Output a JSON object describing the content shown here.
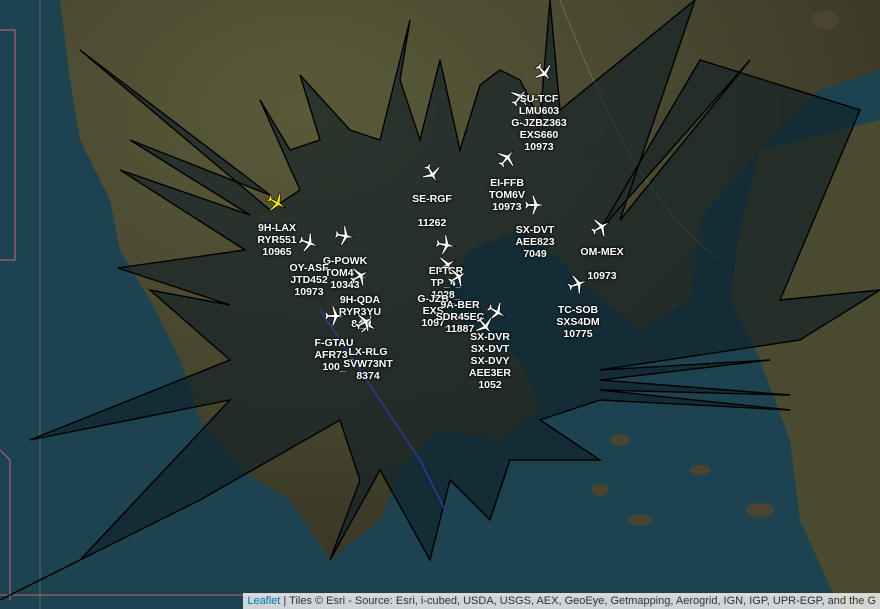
{
  "map": {
    "attribution": {
      "leaflet_link": "Leaflet",
      "separator": " | ",
      "text": "Tiles © Esri - Source: Esri, i-cubed, USDA, USGS, AEX, GeoEye, Getmapping, Aerogrid, IGN, IGP, UPR-EGP, and the G"
    },
    "colors": {
      "plane": "#ffffff",
      "selected_plane": "#f5e400",
      "coverage_fill": "#0e1c24",
      "sea": "#1f4450",
      "land": "#3c3a2a"
    },
    "aircraft": [
      {
        "id": "a1",
        "icon": "plane-icon-selected",
        "labels": [
          "9H-LAX",
          "RYR551",
          "10965"
        ]
      },
      {
        "id": "a2",
        "icon": "plane-icon",
        "labels": []
      },
      {
        "id": "a3",
        "icon": "plane-icon",
        "labels": [
          "G-POWK",
          "TOM4__",
          "10343"
        ]
      },
      {
        "id": "a4",
        "icon": "plane-icon",
        "labels": [
          "OY-ASF",
          "JTD452",
          "10973"
        ]
      },
      {
        "id": "a5",
        "icon": "plane-icon",
        "labels": [
          "9H-QDA",
          "RYR3YU",
          "8__"
        ]
      },
      {
        "id": "a6",
        "icon": "plane-icon",
        "labels": [
          "F-GTAU",
          "AFR73_",
          "100_"
        ]
      },
      {
        "id": "a7",
        "icon": "plane-icon",
        "labels": [
          "LX-RLG",
          "SVW73NT",
          "8374"
        ]
      },
      {
        "id": "a8",
        "icon": "plane-icon",
        "labels": [
          "SE-RGF",
          "",
          "11262"
        ]
      },
      {
        "id": "a9",
        "icon": "plane-icon",
        "labels": []
      },
      {
        "id": "a10",
        "icon": "plane-icon",
        "labels": [
          "EI-TSR",
          "TP_4_",
          "1028_"
        ]
      },
      {
        "id": "a11",
        "icon": "plane-icon",
        "labels": [
          "G-JZB_",
          "EXS_",
          "1097_"
        ]
      },
      {
        "id": "a12",
        "icon": "plane-icon",
        "labels": [
          "9A-BER",
          "SDR45EC",
          "11887"
        ]
      },
      {
        "id": "a13",
        "icon": "plane-icon",
        "labels": [
          "SX-DVR",
          "SX-DVT",
          "SX-DVY",
          "AEE3ER",
          "1052"
        ]
      },
      {
        "id": "a14",
        "icon": "plane-icon",
        "labels": [
          "SU-TCF",
          "LMU603",
          "G-JZBZ363",
          "EXS660",
          "10973"
        ]
      },
      {
        "id": "a15",
        "icon": "plane-icon",
        "labels": []
      },
      {
        "id": "a16",
        "icon": "plane-icon",
        "labels": [
          "EI-FFB",
          "TOM6V",
          "10973"
        ]
      },
      {
        "id": "a17",
        "icon": "plane-icon",
        "labels": [
          "SX-DVT",
          "AEE823",
          "7049"
        ]
      },
      {
        "id": "a18",
        "icon": "plane-icon",
        "labels": [
          "OM-MEX",
          "",
          "10973"
        ]
      },
      {
        "id": "a19",
        "icon": "plane-icon",
        "labels": [
          "TC-SOB",
          "SXS4DM",
          "10775"
        ]
      }
    ]
  }
}
